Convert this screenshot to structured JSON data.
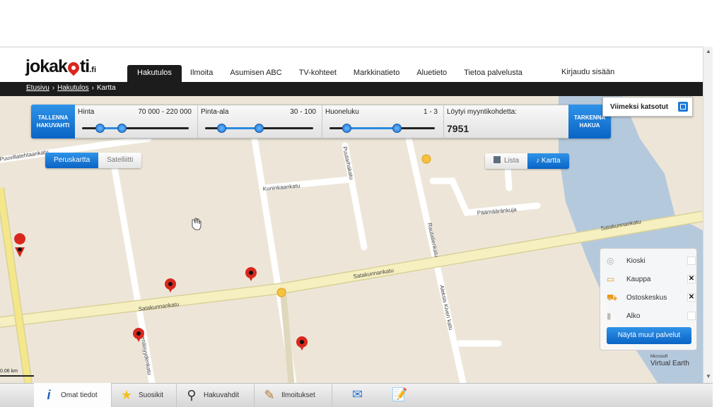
{
  "header": {
    "logo_main": "jokakoti",
    "logo_suffix": ".fi",
    "nav": [
      {
        "label": "Hakutulos",
        "active": true
      },
      {
        "label": "Ilmoita"
      },
      {
        "label": "Asumisen ABC"
      },
      {
        "label": "TV-kohteet"
      },
      {
        "label": "Markkinatieto"
      },
      {
        "label": "Aluetieto"
      },
      {
        "label": "Tietoa palvelusta"
      }
    ],
    "login": "Kirjaudu sisään"
  },
  "breadcrumb": {
    "items": [
      "Etusivu",
      "Hakutulos",
      "Kartta"
    ]
  },
  "search": {
    "save_label_1": "TALLENNA",
    "save_label_2": "HAKUVAHTI",
    "refine_label_1": "TARKENNA",
    "refine_label_2": "HAKUA",
    "filters": [
      {
        "label": "Hinta",
        "range": "70 000 - 220 000",
        "low": 70000,
        "high": 220000
      },
      {
        "label": "Pinta-ala",
        "range": "30 - 100",
        "low": 30,
        "high": 100
      },
      {
        "label": "Huoneluku",
        "range": "1 - 3",
        "low": 1,
        "high": 3
      }
    ],
    "results_label": "Löytyi myyntikohdetta:",
    "results_count": "7951"
  },
  "recent": {
    "label": "Viimeksi katsotut"
  },
  "map_type": {
    "options": [
      "Peruskartta",
      "Satelliitti"
    ],
    "selected": "Peruskartta"
  },
  "view_type": {
    "options": [
      "Lista",
      "Kartta"
    ],
    "selected": "Kartta"
  },
  "map": {
    "streets": [
      "Puuvillatehtaankatu",
      "Kuninkaankatu",
      "Puutarhakatu",
      "Päämääränkuja",
      "Satakunnankatu",
      "Satakunnankatu",
      "Satakunnankatu",
      "Itsenäisyydenkatu",
      "Aleksis Kiven katu",
      "Rautatienkatu"
    ],
    "listing_count": 6,
    "attribution": "Virtual Earth",
    "attribution_small": "Microsoft",
    "scale": "0.06 km"
  },
  "services": {
    "items": [
      {
        "label": "Kioski",
        "checked": false,
        "icon": "kiosk-icon"
      },
      {
        "label": "Kauppa",
        "checked": true,
        "icon": "shop-icon"
      },
      {
        "label": "Ostoskeskus",
        "checked": true,
        "icon": "cart-icon"
      },
      {
        "label": "Alko",
        "checked": false,
        "icon": "bottle-icon"
      }
    ],
    "check_mark": "✕",
    "more_button": "Näytä muut palvelut"
  },
  "bottom_bar": {
    "items": [
      {
        "label": "Omat tiedot",
        "icon": "info-icon"
      },
      {
        "label": "Suosikit",
        "icon": "star-icon"
      },
      {
        "label": "Hakuvahdit",
        "icon": "magnifier-icon"
      },
      {
        "label": "Ilmoitukset",
        "icon": "pencil-icon"
      }
    ],
    "extra_icons": [
      "mail-icon",
      "notepad-icon"
    ]
  },
  "colors": {
    "accent_blue": "#0a64c5",
    "nav_dark": "#1c1c1c",
    "map_bg": "#ede6d8",
    "major_road": "#f6efc0",
    "marker_red": "#d9271d"
  }
}
